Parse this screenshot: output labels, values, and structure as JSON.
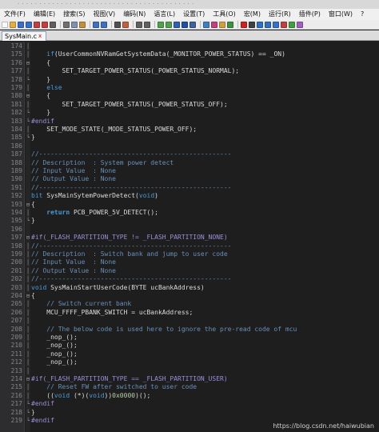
{
  "window": {
    "title_obscured": "· · · · · · · · · · · · · · · · · · · · · · · · · · · · · · · · · · · · · · · · ·"
  },
  "menu": [
    "文件(F)",
    "编辑(E)",
    "搜索(S)",
    "视图(V)",
    "编码(N)",
    "语言(L)",
    "设置(T)",
    "工具(O)",
    "宏(M)",
    "运行(R)",
    "插件(P)",
    "窗口(W)",
    "?"
  ],
  "toolbar": {
    "buttons": [
      {
        "icon": "new-file-icon",
        "color": "#f8f8f8"
      },
      {
        "icon": "open-file-icon",
        "color": "#e0b040"
      },
      {
        "icon": "save-icon",
        "color": "#3a6fc8"
      },
      {
        "icon": "save-all-icon",
        "color": "#3a6fc8"
      },
      {
        "icon": "close-icon",
        "color": "#c04040"
      },
      {
        "icon": "close-all-icon",
        "color": "#c04040"
      },
      {
        "icon": "print-icon",
        "color": "#606060"
      },
      {
        "sep": true
      },
      {
        "icon": "cut-icon",
        "color": "#707070"
      },
      {
        "icon": "copy-icon",
        "color": "#8090b0"
      },
      {
        "icon": "paste-icon",
        "color": "#c09040"
      },
      {
        "sep": true
      },
      {
        "icon": "undo-icon",
        "color": "#4070c0"
      },
      {
        "icon": "redo-icon",
        "color": "#4070c0"
      },
      {
        "sep": true
      },
      {
        "icon": "find-icon",
        "color": "#505050"
      },
      {
        "icon": "replace-icon",
        "color": "#c06040"
      },
      {
        "sep": true
      },
      {
        "icon": "zoom-in-icon",
        "color": "#606060"
      },
      {
        "icon": "zoom-out-icon",
        "color": "#606060"
      },
      {
        "sep": true
      },
      {
        "icon": "sync-vertical-icon",
        "color": "#50a050"
      },
      {
        "icon": "sync-horizontal-icon",
        "color": "#50a050"
      },
      {
        "icon": "word-wrap-icon",
        "color": "#3060b0"
      },
      {
        "icon": "show-all-chars-icon",
        "color": "#2050a0"
      },
      {
        "icon": "indent-guide-icon",
        "color": "#4060a0"
      },
      {
        "sep": true
      },
      {
        "icon": "doc-map-icon",
        "color": "#4080c0"
      },
      {
        "icon": "function-list-icon",
        "color": "#c04080"
      },
      {
        "icon": "folder-workspace-icon",
        "color": "#d0a040"
      },
      {
        "icon": "monitoring-icon",
        "color": "#409040"
      },
      {
        "sep": true
      },
      {
        "icon": "record-macro-icon",
        "color": "#d02020"
      },
      {
        "icon": "stop-record-icon",
        "color": "#404040"
      },
      {
        "icon": "play-macro-icon",
        "color": "#3070c0"
      },
      {
        "icon": "run-macro-multiple-icon",
        "color": "#3070c0"
      },
      {
        "icon": "save-macro-icon",
        "color": "#3a6fc8"
      },
      {
        "icon": "spellcheck-icon",
        "color": "#c04040"
      },
      {
        "icon": "compare-icon",
        "color": "#40a040"
      },
      {
        "icon": "plugin-icon",
        "color": "#a060c0"
      }
    ]
  },
  "tabs": [
    {
      "label": "SysMain.c",
      "close_glyph": "x"
    }
  ],
  "editor": {
    "colors": {
      "background": "#1e1e1e",
      "keyword": "#4a9bd6",
      "comment": "#6a8fb8",
      "preprocessor": "#9b8fd8",
      "identifier": "#dcdcdc",
      "line_number": "#858585"
    },
    "lines": [
      {
        "n": "174",
        "fold": "│",
        "tokens": [
          {
            "t": "pu",
            "v": ""
          }
        ]
      },
      {
        "n": "175",
        "fold": "│",
        "tokens": [
          {
            "t": "pu",
            "v": "    "
          },
          {
            "t": "kw",
            "v": "if"
          },
          {
            "t": "id",
            "v": "(UserCommonNVRamGetSystemData(_MONITOR_POWER_STATUS) == _ON)"
          }
        ]
      },
      {
        "n": "176",
        "fold": "⊟",
        "tokens": [
          {
            "t": "pu",
            "v": "    {"
          }
        ]
      },
      {
        "n": "177",
        "fold": "│",
        "tokens": [
          {
            "t": "id",
            "v": "        SET_TARGET_POWER_STATUS(_POWER_STATUS_NORMAL);"
          }
        ]
      },
      {
        "n": "178",
        "fold": "└",
        "tokens": [
          {
            "t": "pu",
            "v": "    }"
          }
        ]
      },
      {
        "n": "179",
        "fold": "│",
        "tokens": [
          {
            "t": "pu",
            "v": "    "
          },
          {
            "t": "kw",
            "v": "else"
          }
        ]
      },
      {
        "n": "180",
        "fold": "⊟",
        "tokens": [
          {
            "t": "pu",
            "v": "    {"
          }
        ]
      },
      {
        "n": "181",
        "fold": "│",
        "tokens": [
          {
            "t": "id",
            "v": "        SET_TARGET_POWER_STATUS(_POWER_STATUS_OFF);"
          }
        ]
      },
      {
        "n": "182",
        "fold": "└",
        "tokens": [
          {
            "t": "pu",
            "v": "    }"
          }
        ]
      },
      {
        "n": "183",
        "fold": "└",
        "tokens": [
          {
            "t": "pp",
            "v": "#endif"
          }
        ]
      },
      {
        "n": "184",
        "fold": "│",
        "tokens": [
          {
            "t": "id",
            "v": "    SET_MODE_STATE(_MODE_STATUS_POWER_OFF);"
          }
        ]
      },
      {
        "n": "185",
        "fold": "└",
        "tokens": [
          {
            "t": "pu",
            "v": "}"
          }
        ]
      },
      {
        "n": "186",
        "fold": "",
        "tokens": [
          {
            "t": "pu",
            "v": ""
          }
        ]
      },
      {
        "n": "187",
        "fold": "",
        "tokens": [
          {
            "t": "cm",
            "v": "//--------------------------------------------------"
          }
        ]
      },
      {
        "n": "188",
        "fold": "",
        "tokens": [
          {
            "t": "cm",
            "v": "// Description  : System power detect"
          }
        ]
      },
      {
        "n": "189",
        "fold": "",
        "tokens": [
          {
            "t": "cm",
            "v": "// Input Value  : None"
          }
        ]
      },
      {
        "n": "190",
        "fold": "",
        "tokens": [
          {
            "t": "cm",
            "v": "// Output Value : None"
          }
        ]
      },
      {
        "n": "191",
        "fold": "",
        "tokens": [
          {
            "t": "cm",
            "v": "//--------------------------------------------------"
          }
        ]
      },
      {
        "n": "192",
        "fold": "",
        "tokens": [
          {
            "t": "kw",
            "v": "bit"
          },
          {
            "t": "id",
            "v": " SysMainSytemPowerDetect("
          },
          {
            "t": "kw",
            "v": "void"
          },
          {
            "t": "id",
            "v": ")"
          }
        ]
      },
      {
        "n": "193",
        "fold": "⊟",
        "tokens": [
          {
            "t": "pu",
            "v": "{"
          }
        ]
      },
      {
        "n": "194",
        "fold": "│",
        "tokens": [
          {
            "t": "pu",
            "v": "    "
          },
          {
            "t": "kwb",
            "v": "return"
          },
          {
            "t": "id",
            "v": " PCB_POWER_5V_DETECT();"
          }
        ]
      },
      {
        "n": "195",
        "fold": "└",
        "tokens": [
          {
            "t": "pu",
            "v": "}"
          }
        ]
      },
      {
        "n": "196",
        "fold": "",
        "tokens": [
          {
            "t": "pu",
            "v": ""
          }
        ]
      },
      {
        "n": "197",
        "fold": "⊟",
        "tokens": [
          {
            "t": "pp",
            "v": "#if(_FLASH_PARTITION_TYPE != _FLASH_PARTITION_NONE)"
          }
        ]
      },
      {
        "n": "198",
        "fold": "│",
        "tokens": [
          {
            "t": "cm",
            "v": "//--------------------------------------------------"
          }
        ]
      },
      {
        "n": "199",
        "fold": "│",
        "tokens": [
          {
            "t": "cm",
            "v": "// Description  : Switch bank and jump to user code"
          }
        ]
      },
      {
        "n": "200",
        "fold": "│",
        "tokens": [
          {
            "t": "cm",
            "v": "// Input Value  : None"
          }
        ]
      },
      {
        "n": "201",
        "fold": "│",
        "tokens": [
          {
            "t": "cm",
            "v": "// Output Value : None"
          }
        ]
      },
      {
        "n": "202",
        "fold": "│",
        "tokens": [
          {
            "t": "cm",
            "v": "//--------------------------------------------------"
          }
        ]
      },
      {
        "n": "203",
        "fold": "│",
        "tokens": [
          {
            "t": "kw",
            "v": "void"
          },
          {
            "t": "id",
            "v": " SysMainStartUserCode(BYTE ucBankAddress)"
          }
        ]
      },
      {
        "n": "204",
        "fold": "⊟",
        "tokens": [
          {
            "t": "pu",
            "v": "{"
          }
        ]
      },
      {
        "n": "205",
        "fold": "│",
        "tokens": [
          {
            "t": "cm",
            "v": "    // Switch current bank"
          }
        ]
      },
      {
        "n": "206",
        "fold": "│",
        "tokens": [
          {
            "t": "id",
            "v": "    MCU_FFFF_PBANK_SWITCH = ucBankAddress;"
          }
        ]
      },
      {
        "n": "207",
        "fold": "│",
        "tokens": [
          {
            "t": "pu",
            "v": ""
          }
        ]
      },
      {
        "n": "208",
        "fold": "│",
        "tokens": [
          {
            "t": "cm",
            "v": "    // The below code is used here to ignore the pre-read code of mcu"
          }
        ]
      },
      {
        "n": "209",
        "fold": "│",
        "tokens": [
          {
            "t": "id",
            "v": "    _nop_();"
          }
        ]
      },
      {
        "n": "210",
        "fold": "│",
        "tokens": [
          {
            "t": "id",
            "v": "    _nop_();"
          }
        ]
      },
      {
        "n": "211",
        "fold": "│",
        "tokens": [
          {
            "t": "id",
            "v": "    _nop_();"
          }
        ]
      },
      {
        "n": "212",
        "fold": "│",
        "tokens": [
          {
            "t": "id",
            "v": "    _nop_();"
          }
        ]
      },
      {
        "n": "213",
        "fold": "│",
        "tokens": [
          {
            "t": "pu",
            "v": ""
          }
        ]
      },
      {
        "n": "214",
        "fold": "⊟",
        "tokens": [
          {
            "t": "pp",
            "v": "#if(_FLASH_PARTITION_TYPE == _FLASH_PARTITION_USER)"
          }
        ]
      },
      {
        "n": "215",
        "fold": "│",
        "tokens": [
          {
            "t": "cm",
            "v": "    // Reset FW after switched to user code"
          }
        ]
      },
      {
        "n": "216",
        "fold": "│",
        "tokens": [
          {
            "t": "id",
            "v": "    (("
          },
          {
            "t": "kw",
            "v": "void"
          },
          {
            "t": "id",
            "v": " (*)("
          },
          {
            "t": "kw",
            "v": "void"
          },
          {
            "t": "id",
            "v": "))"
          },
          {
            "t": "num",
            "v": "0x0000"
          },
          {
            "t": "id",
            "v": ")();"
          }
        ]
      },
      {
        "n": "217",
        "fold": "└",
        "tokens": [
          {
            "t": "pp",
            "v": "#endif"
          }
        ]
      },
      {
        "n": "218",
        "fold": "└",
        "tokens": [
          {
            "t": "pu",
            "v": "}"
          }
        ]
      },
      {
        "n": "219",
        "fold": "└",
        "tokens": [
          {
            "t": "pp",
            "v": "#endif"
          }
        ]
      }
    ]
  },
  "watermark": "https://blog.csdn.net/haiwubian"
}
